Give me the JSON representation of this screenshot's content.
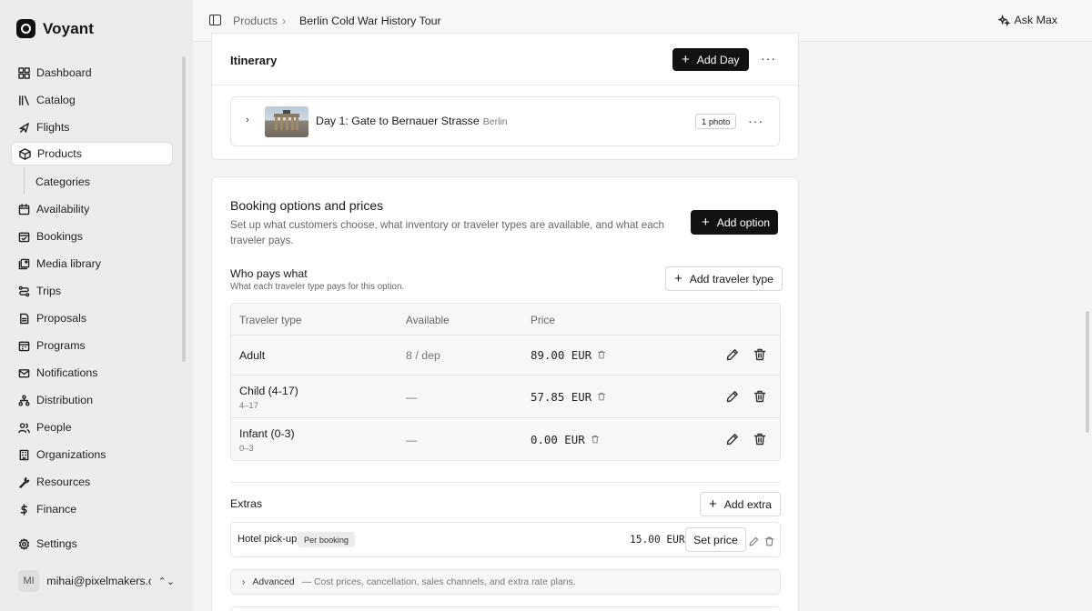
{
  "app": {
    "name": "Voyant"
  },
  "sidebar": {
    "items": [
      {
        "label": "Dashboard",
        "icon": "dashboard-icon"
      },
      {
        "label": "Catalog",
        "icon": "catalog-icon"
      },
      {
        "label": "Flights",
        "icon": "plane-icon"
      },
      {
        "label": "Products",
        "icon": "box-icon",
        "active": true
      },
      {
        "label": "Categories",
        "icon": ""
      },
      {
        "label": "Availability",
        "icon": "calendar-icon"
      },
      {
        "label": "Bookings",
        "icon": "calendar-check-icon"
      },
      {
        "label": "Media library",
        "icon": "images-icon"
      },
      {
        "label": "Trips",
        "icon": "route-icon"
      },
      {
        "label": "Proposals",
        "icon": "document-icon"
      },
      {
        "label": "Programs",
        "icon": "calendar-grid-icon"
      },
      {
        "label": "Notifications",
        "icon": "mail-icon"
      },
      {
        "label": "Distribution",
        "icon": "network-icon"
      },
      {
        "label": "People",
        "icon": "users-icon"
      },
      {
        "label": "Organizations",
        "icon": "building-icon"
      },
      {
        "label": "Resources",
        "icon": "wrench-icon"
      },
      {
        "label": "Finance",
        "icon": "dollar-icon"
      }
    ],
    "settings_label": "Settings",
    "user": {
      "initials": "MI",
      "email": "mihai@pixelmakers.c..."
    }
  },
  "header": {
    "breadcrumb": [
      "Products",
      "Berlin Cold War History Tour"
    ],
    "ask_label": "Ask Max"
  },
  "itinerary": {
    "title": "Itinerary",
    "add_day_label": "Add Day",
    "days": [
      {
        "title": "Day 1: Gate to Bernauer Strasse",
        "city": "Berlin",
        "badge": "1 photo"
      }
    ]
  },
  "booking": {
    "title": "Booking options and prices",
    "description": "Set up what customers choose, what inventory or traveler types are available, and what each traveler pays.",
    "add_option_label": "Add option",
    "who_pays": {
      "title": "Who pays what",
      "subtitle": "What each traveler type pays for this option.",
      "add_traveler_label": "Add traveler type",
      "columns": [
        "Traveler type",
        "Available",
        "Price"
      ],
      "rows": [
        {
          "name": "Adult",
          "range": "",
          "available": "8 / dep",
          "price": "89.00 EUR"
        },
        {
          "name": "Child (4-17)",
          "range": "4–17",
          "available": "—",
          "price": "57.85 EUR"
        },
        {
          "name": "Infant (0-3)",
          "range": "0–3",
          "available": "—",
          "price": "0.00 EUR"
        }
      ]
    },
    "extras": {
      "title": "Extras",
      "add_extra_label": "Add extra",
      "items": [
        {
          "name": "Hotel pick-up",
          "badge": "Per booking",
          "price": "15.00 EUR",
          "set_price_label": "Set price"
        }
      ]
    },
    "advanced": {
      "label": "Advanced",
      "description": "— Cost prices, cancellation, sales channels, and extra rate plans."
    }
  }
}
